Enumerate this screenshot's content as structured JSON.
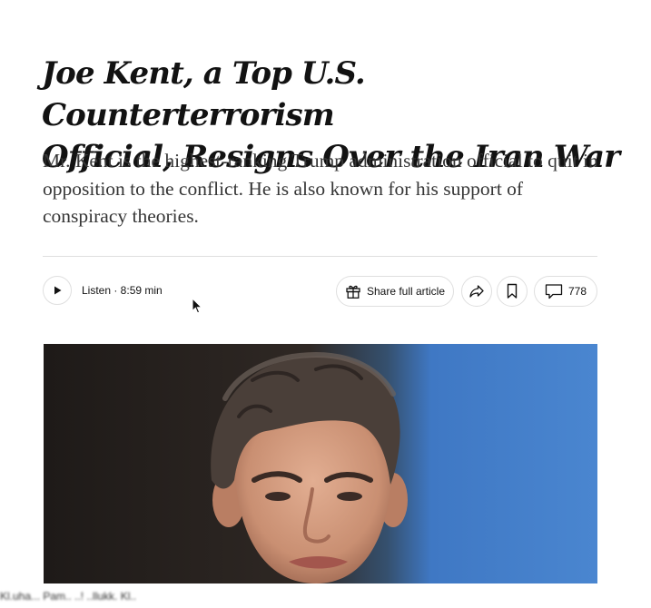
{
  "article": {
    "headline_line1": "Joe Kent, a Top U.S. Counterterrorism",
    "headline_line2": "Official, Resigns Over the Iran War",
    "summary": "Mr. Kent is the highest-ranking Trump administration official to quit in opposition to the conflict. He is also known for his support of conspiracy theories."
  },
  "toolbar": {
    "listen_label": "Listen · 8:59 min",
    "share_label": "Share full article",
    "comments_count": "778"
  },
  "icons": {
    "play": "play-icon",
    "gift": "gift-icon",
    "share": "share-arrow-icon",
    "bookmark": "bookmark-icon",
    "comment": "comment-bubble-icon",
    "cursor": "mouse-pointer-icon"
  },
  "colors": {
    "text": "#121212",
    "summary_text": "#363636",
    "divider": "#dfdfdf",
    "photo_backdrop_blue": "#3f78c4"
  },
  "photo": {
    "alt": "Photo of Joe Kent"
  },
  "caption_fragment": "Kl.uha... Pam.. ..! ..llukk. Kl.."
}
